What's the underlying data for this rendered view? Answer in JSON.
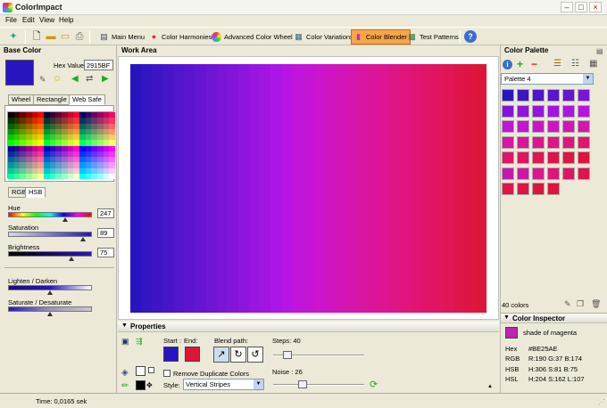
{
  "window": {
    "title": "ColorImpact",
    "min": "–",
    "max": "□",
    "close": "×"
  },
  "menu": [
    "File",
    "Edit",
    "View",
    "Help"
  ],
  "toolbar": {
    "buttons": [
      {
        "label": "Main Menu",
        "icon": "main-menu-icon"
      },
      {
        "label": "Color Harmonies",
        "icon": "harmonies-icon"
      },
      {
        "label": "Advanced Color Wheel",
        "icon": "color-wheel-icon"
      },
      {
        "label": "Color Variations",
        "icon": "variations-icon"
      },
      {
        "label": "Color Blender",
        "icon": "blender-icon",
        "active": true
      },
      {
        "label": "Test Patterns",
        "icon": "test-patterns-icon"
      }
    ],
    "help": "?"
  },
  "base_color": {
    "title": "Base Color",
    "hex_label": "Hex Value:",
    "hex_value": "2915BF",
    "swatch": "#2915BF",
    "tabs": [
      "Wheel",
      "Rectangle",
      "Web Safe"
    ],
    "selected_tab": "Web Safe",
    "model_tabs": [
      "RGB",
      "HSB"
    ],
    "selected_model": "HSB",
    "sliders": [
      {
        "label": "Hue",
        "value": "247",
        "level": 0.686
      },
      {
        "label": "Saturation",
        "value": "89",
        "level": 0.89
      },
      {
        "label": "Brightness",
        "value": "75",
        "level": 0.75
      }
    ],
    "lighten": {
      "label": "Lighten / Darken",
      "level": 0.5
    },
    "saturate": {
      "label": "Saturate / Desaturate",
      "level": 0.5
    }
  },
  "work_area": {
    "title": "Work Area",
    "stripes": [
      "#2915BF",
      "#3315C2",
      "#3D15C5",
      "#4715C8",
      "#5115CB",
      "#5B15CE",
      "#6515D1",
      "#6F15D4",
      "#7915D7",
      "#8315DA",
      "#8D15DD",
      "#9715E0",
      "#A115E3",
      "#AB15E6",
      "#B515E2",
      "#BF15DC",
      "#C515D4",
      "#CB15CC",
      "#CF15C2",
      "#D315B8",
      "#D615AE",
      "#D915A4",
      "#DB159A",
      "#DD1590",
      "#DE1586",
      "#DF157C",
      "#E01572",
      "#E01568",
      "#E0155E",
      "#E01554",
      "#DF154A",
      "#DE1540",
      "#DD1538"
    ]
  },
  "properties": {
    "title": "Properties",
    "start_label": "Start :",
    "end_label": "End:",
    "start_color": "#2915BF",
    "end_color": "#DD1538",
    "blend_path_label": "Blend path:",
    "steps_label": "Steps: 40",
    "steps_level": 0.1,
    "noise_label": "Noise : 26",
    "noise_level": 0.26,
    "remove_dup_label": "Remove Duplicate Colors",
    "style_label": "Style:",
    "style_value": "Vertical Stripes"
  },
  "palette": {
    "title": "Color Palette",
    "selected": "Palette 4",
    "count": "40 colors",
    "colors": [
      "#2915BF",
      "#3D15C5",
      "#5115CB",
      "#5B15CE",
      "#6515D1",
      "#7915D7",
      "#8315DA",
      "#8D15DD",
      "#9715E0",
      "#A115E3",
      "#AB15E6",
      "#B515E2",
      "#BF15DC",
      "#C515D4",
      "#CB15CC",
      "#CF15C2",
      "#D315B8",
      "#D615AE",
      "#D915A4",
      "#DB159A",
      "#DD1590",
      "#DE1586",
      "#DF157C",
      "#E01572",
      "#E01568",
      "#E0155E",
      "#E01554",
      "#DF154A",
      "#DE1540",
      "#DD1538",
      "#C31BA8",
      "#D015A6",
      "#E0158C",
      "#E0157A",
      "#E01560",
      "#E0154C",
      "#DF1548",
      "#DE1544",
      "#DD153C",
      "#DD1538"
    ]
  },
  "inspector": {
    "title": "Color Inspector",
    "swatch": "#BE25AE",
    "name": "shade of magenta",
    "hex_label": "Hex",
    "hex": "#BE25AE",
    "rgb_label": "RGB",
    "rgb": "R:190  G:37  B:174",
    "hsb_label": "HSB",
    "hsb": "H:306  S:81  B:75",
    "hsl_label": "HSL",
    "hsl": "H:204  S:162  L:107"
  },
  "status": {
    "time": "Time: 0,0165 sek"
  }
}
